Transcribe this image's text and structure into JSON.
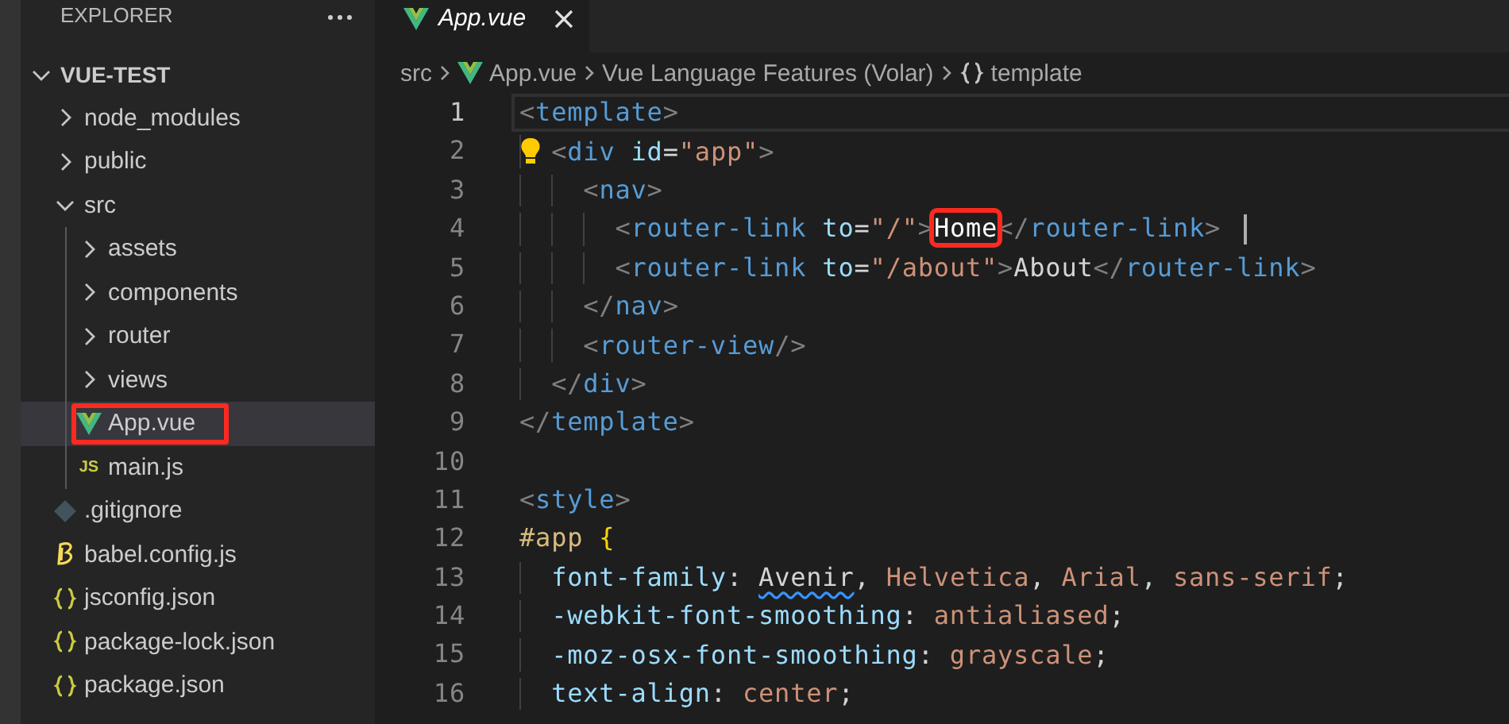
{
  "explorer": {
    "title": "EXPLORER",
    "tree": [
      {
        "label": "VUE-TEST",
        "kind": "folder",
        "expanded": true,
        "selected": false,
        "children": [
          {
            "label": "node_modules",
            "kind": "folder",
            "expanded": false,
            "selected": false
          },
          {
            "label": "public",
            "kind": "folder",
            "expanded": false,
            "selected": false
          },
          {
            "label": "src",
            "kind": "folder",
            "expanded": true,
            "selected": false,
            "children": [
              {
                "label": "assets",
                "kind": "folder",
                "expanded": false,
                "selected": false
              },
              {
                "label": "components",
                "kind": "folder",
                "expanded": false,
                "selected": false
              },
              {
                "label": "router",
                "kind": "folder",
                "expanded": false,
                "selected": false
              },
              {
                "label": "views",
                "kind": "folder",
                "expanded": false,
                "selected": false
              },
              {
                "label": "App.vue",
                "kind": "vue",
                "selected": true,
                "annotated": true
              },
              {
                "label": "main.js",
                "kind": "js",
                "icon_text": "JS",
                "selected": false
              }
            ]
          },
          {
            "label": ".gitignore",
            "kind": "git",
            "selected": false
          },
          {
            "label": "babel.config.js",
            "kind": "babel",
            "selected": false
          },
          {
            "label": "jsconfig.json",
            "kind": "json",
            "selected": false
          },
          {
            "label": "package-lock.json",
            "kind": "json",
            "selected": false
          },
          {
            "label": "package.json",
            "kind": "json",
            "selected": false
          }
        ]
      }
    ]
  },
  "tabs": [
    {
      "label": "App.vue",
      "kind": "vue",
      "preview": true,
      "selected": true
    }
  ],
  "breadcrumbs": [
    {
      "label": "src",
      "kind": "plain"
    },
    {
      "label": "App.vue",
      "kind": "vue"
    },
    {
      "label": "Vue Language Features (Volar)",
      "kind": "plain"
    },
    {
      "label": "template",
      "kind": "braces"
    }
  ],
  "lines": [
    {
      "number": "1",
      "current": true,
      "tokens": [
        {
          "text": "<",
          "kind": "punct"
        },
        {
          "text": "template",
          "kind": "tag"
        },
        {
          "text": ">",
          "kind": "punct"
        }
      ]
    },
    {
      "number": "2",
      "current": false,
      "lightbulb": true,
      "tokens": [
        {
          "text": "  <",
          "kind": "punct"
        },
        {
          "text": "div",
          "kind": "tag"
        },
        {
          "text": " id",
          "kind": "attr"
        },
        {
          "text": "=",
          "kind": "op"
        },
        {
          "text": "\"app\"",
          "kind": "string"
        },
        {
          "text": ">",
          "kind": "punct"
        }
      ]
    },
    {
      "number": "3",
      "current": false,
      "tokens": [
        {
          "text": "    <",
          "kind": "punct"
        },
        {
          "text": "nav",
          "kind": "tag"
        },
        {
          "text": ">",
          "kind": "punct"
        }
      ]
    },
    {
      "number": "4",
      "current": false,
      "cursor": true,
      "tokens": [
        {
          "text": "      <",
          "kind": "punct"
        },
        {
          "text": "router-link",
          "kind": "tag"
        },
        {
          "text": " to",
          "kind": "attr"
        },
        {
          "text": "=",
          "kind": "op"
        },
        {
          "text": "\"/\"",
          "kind": "string"
        },
        {
          "text": ">",
          "kind": "punct"
        },
        {
          "text": "Home",
          "kind": "text",
          "annotated": true
        },
        {
          "text": "</",
          "kind": "punct"
        },
        {
          "text": "router-link",
          "kind": "tag"
        },
        {
          "text": "> ",
          "kind": "punct"
        }
      ]
    },
    {
      "number": "5",
      "current": false,
      "tokens": [
        {
          "text": "      <",
          "kind": "punct"
        },
        {
          "text": "router-link",
          "kind": "tag"
        },
        {
          "text": " to",
          "kind": "attr"
        },
        {
          "text": "=",
          "kind": "op"
        },
        {
          "text": "\"/about\"",
          "kind": "string"
        },
        {
          "text": ">",
          "kind": "punct"
        },
        {
          "text": "About",
          "kind": "text"
        },
        {
          "text": "</",
          "kind": "punct"
        },
        {
          "text": "router-link",
          "kind": "tag"
        },
        {
          "text": ">",
          "kind": "punct"
        }
      ]
    },
    {
      "number": "6",
      "current": false,
      "tokens": [
        {
          "text": "    </",
          "kind": "punct"
        },
        {
          "text": "nav",
          "kind": "tag"
        },
        {
          "text": ">",
          "kind": "punct"
        }
      ]
    },
    {
      "number": "7",
      "current": false,
      "tokens": [
        {
          "text": "    <",
          "kind": "punct"
        },
        {
          "text": "router-view",
          "kind": "tag"
        },
        {
          "text": "/>",
          "kind": "punct"
        }
      ]
    },
    {
      "number": "8",
      "current": false,
      "tokens": [
        {
          "text": "  </",
          "kind": "punct"
        },
        {
          "text": "div",
          "kind": "tag"
        },
        {
          "text": ">",
          "kind": "punct"
        }
      ]
    },
    {
      "number": "9",
      "current": false,
      "tokens": [
        {
          "text": "</",
          "kind": "punct"
        },
        {
          "text": "template",
          "kind": "tag"
        },
        {
          "text": ">",
          "kind": "punct"
        }
      ]
    },
    {
      "number": "10",
      "current": false
    },
    {
      "number": "11",
      "current": false,
      "tokens": [
        {
          "text": "<",
          "kind": "punct"
        },
        {
          "text": "style",
          "kind": "tag"
        },
        {
          "text": ">",
          "kind": "punct"
        }
      ]
    },
    {
      "number": "12",
      "current": false,
      "tokens": [
        {
          "text": "#app",
          "kind": "selector"
        },
        {
          "text": " {",
          "kind": "brace"
        }
      ]
    },
    {
      "number": "13",
      "current": false,
      "tokens": [
        {
          "text": "  font-family",
          "kind": "prop"
        },
        {
          "text": ": ",
          "kind": "op"
        },
        {
          "text": "Avenir",
          "kind": "text",
          "squiggle": true
        },
        {
          "text": ", ",
          "kind": "op"
        },
        {
          "text": "Helvetica",
          "kind": "value"
        },
        {
          "text": ", ",
          "kind": "op"
        },
        {
          "text": "Arial",
          "kind": "value"
        },
        {
          "text": ", ",
          "kind": "op"
        },
        {
          "text": "sans-serif",
          "kind": "value"
        },
        {
          "text": ";",
          "kind": "op"
        }
      ]
    },
    {
      "number": "14",
      "current": false,
      "tokens": [
        {
          "text": "  -webkit-font-smoothing",
          "kind": "prop"
        },
        {
          "text": ": ",
          "kind": "op"
        },
        {
          "text": "antialiased",
          "kind": "value"
        },
        {
          "text": ";",
          "kind": "op"
        }
      ]
    },
    {
      "number": "15",
      "current": false,
      "tokens": [
        {
          "text": "  -moz-osx-font-smoothing",
          "kind": "prop"
        },
        {
          "text": ": ",
          "kind": "op"
        },
        {
          "text": "grayscale",
          "kind": "value"
        },
        {
          "text": ";",
          "kind": "op"
        }
      ]
    },
    {
      "number": "16",
      "current": false,
      "tokens": [
        {
          "text": "  text-align",
          "kind": "prop"
        },
        {
          "text": ": ",
          "kind": "op"
        },
        {
          "text": "center",
          "kind": "value"
        },
        {
          "text": ";",
          "kind": "op"
        }
      ]
    }
  ]
}
